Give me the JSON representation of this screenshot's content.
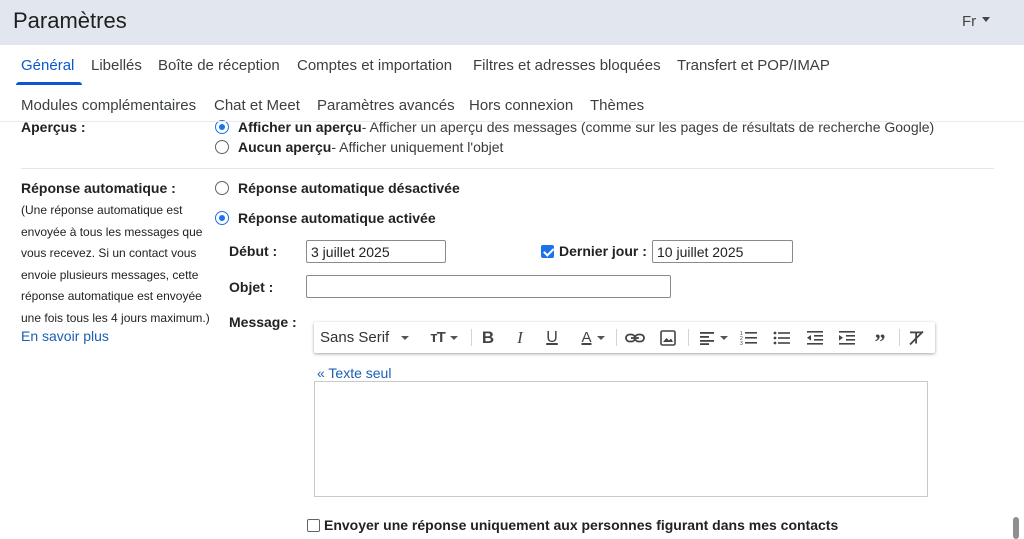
{
  "header": {
    "title": "Paramètres",
    "language_label": "Fr"
  },
  "tabs": [
    {
      "label": "Général",
      "active": true
    },
    {
      "label": "Libellés"
    },
    {
      "label": "Boîte de réception"
    },
    {
      "label": "Comptes et importation"
    },
    {
      "label": "Filtres et adresses bloquées"
    },
    {
      "label": "Transfert et POP/IMAP"
    },
    {
      "label": "Modules complémentaires"
    },
    {
      "label": "Chat et Meet"
    },
    {
      "label": "Paramètres avancés"
    },
    {
      "label": "Hors connexion"
    },
    {
      "label": "Thèmes"
    }
  ],
  "previews": {
    "label": "Aperçus :",
    "option1_title": "Afficher un aperçu",
    "option1_desc": " - Afficher un aperçu des messages (comme sur les pages de résultats de recherche Google)",
    "option2_title": "Aucun aperçu",
    "option2_desc": " - Afficher uniquement l'objet"
  },
  "auto_reply": {
    "label": "Réponse automatique :",
    "description": "(Une réponse automatique est envoyée à tous les messages que vous recevez. Si un contact vous envoie plusieurs messages, cette réponse automatique est envoyée une fois tous les 4 jours maximum.)",
    "learn_more": "En savoir plus",
    "off_label": "Réponse automatique désactivée",
    "on_label": "Réponse automatique activée",
    "selected": "on",
    "start_label": "Début :",
    "start_value": "3 juillet 2025",
    "last_day_label": "Dernier jour :",
    "last_day_checked": true,
    "last_day_value": "10 juillet 2025",
    "subject_label": "Objet :",
    "subject_value": "",
    "message_label": "Message :",
    "plain_text_link": "« Texte seul",
    "contacts_only_label": "Envoyer une réponse uniquement aux personnes figurant dans mes contacts",
    "contacts_only_checked": false
  },
  "toolbar": {
    "font_name": "Sans Serif",
    "size_icon": "text-size-icon",
    "bold_glyph": "B",
    "italic_glyph": "I",
    "underline_glyph": "U",
    "text_color_glyph": "A",
    "quote_glyph": "”"
  },
  "colors": {
    "accent": "#0b57d0",
    "header_bg": "#e2e7ef",
    "radio_checked": "#1a73e8",
    "link": "#1a5fb4"
  }
}
